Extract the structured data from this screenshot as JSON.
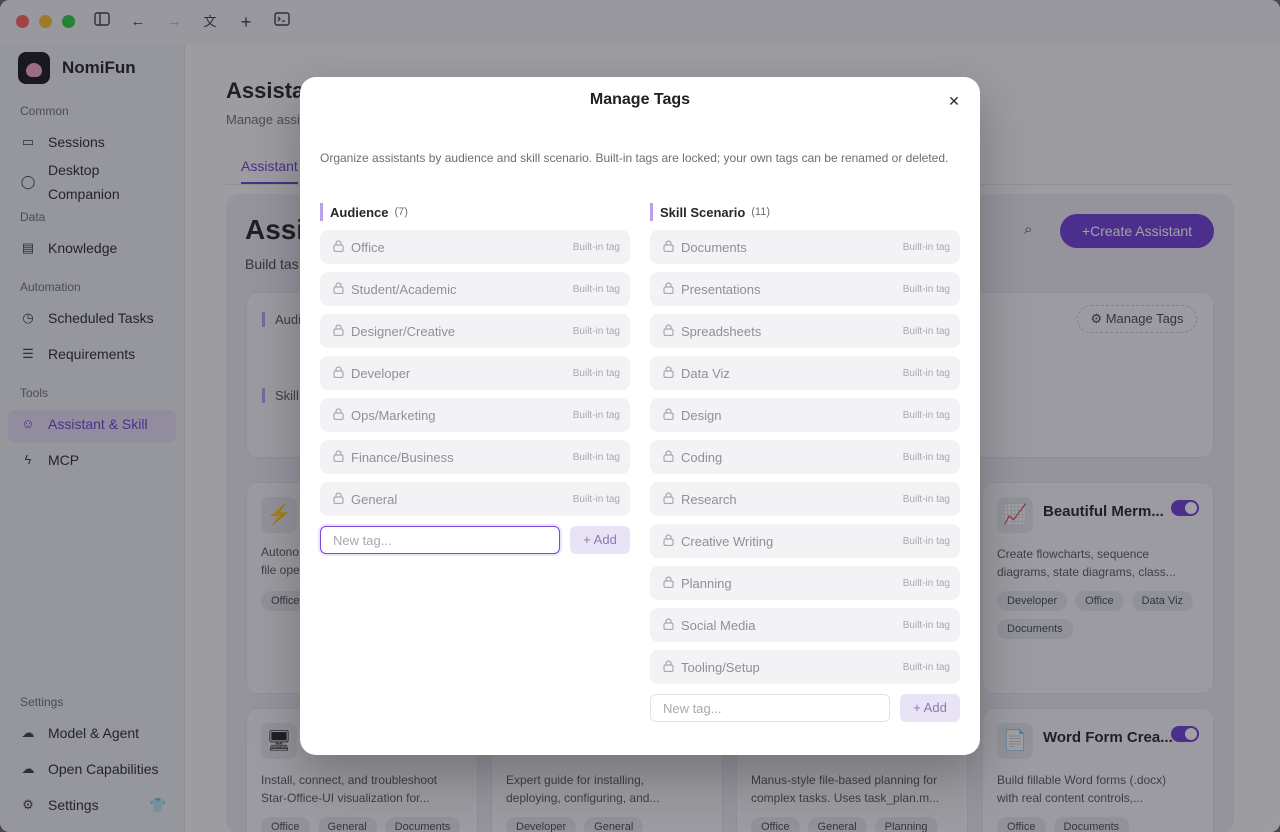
{
  "app": {
    "name": "NomiFun"
  },
  "titlebar": {
    "icons": [
      "sidebar-toggle-icon",
      "back-arrow-icon",
      "forward-arrow-icon",
      "translate-icon",
      "plus-icon",
      "terminal-icon"
    ]
  },
  "sidebar": {
    "sections": {
      "common": "Common",
      "data": "Data",
      "automation": "Automation",
      "tools": "Tools",
      "settings": "Settings"
    },
    "items": {
      "sessions": "Sessions",
      "desktop_companion_1": "Desktop",
      "desktop_companion_2": "Companion",
      "knowledge": "Knowledge",
      "scheduled_tasks": "Scheduled Tasks",
      "requirements": "Requirements",
      "assistant_skill": "Assistant & Skill",
      "mcp": "MCP",
      "model_agent": "Model & Agent",
      "open_capabilities": "Open Capabilities",
      "settings": "Settings"
    }
  },
  "background": {
    "title": "Assista",
    "subtitle": "Manage assi",
    "tab": "Assistant",
    "heading": "Assi",
    "heading_sub": "Build tas",
    "create_button": "+Create Assistant",
    "manage_tags_button": "Manage Tags",
    "filter_audience": "Audie",
    "filter_skill": "Skill",
    "cards": [
      {
        "icon": "⚡",
        "title": "",
        "desc": "Autono\nfile ope",
        "tags": [
          "Office"
        ]
      },
      {
        "icon": "📈",
        "title": "Beautiful Merm...",
        "desc": "Create flowcharts, sequence diagrams, state diagrams, class...",
        "tags": [
          "Developer",
          "Office",
          "Data Viz",
          "Documents"
        ]
      },
      {
        "icon": "🖥",
        "title": "",
        "desc": "Install, connect, and troubleshoot Star-Office-UI visualization for...",
        "tags": [
          "Office",
          "General",
          "Documents"
        ]
      },
      {
        "icon": "",
        "title": "",
        "desc": "Expert guide for installing, deploying, configuring, and...",
        "tags": [
          "Developer",
          "General"
        ]
      },
      {
        "icon": "",
        "title": "",
        "desc": "Manus-style file-based planning for complex tasks. Uses task_plan.m...",
        "tags": [
          "Office",
          "General",
          "Planning"
        ]
      },
      {
        "icon": "📄",
        "title": "Word Form Crea...",
        "desc": "Build fillable Word forms (.docx) with real content controls,...",
        "tags": [
          "Office",
          "Documents"
        ]
      }
    ]
  },
  "modal": {
    "title": "Manage Tags",
    "description": "Organize assistants by audience and skill scenario. Built-in tags are locked; your own tags can be renamed or deleted.",
    "builtin_label": "Built-in tag",
    "audience": {
      "title": "Audience",
      "count": "(7)",
      "tags": [
        "Office",
        "Student/Academic",
        "Designer/Creative",
        "Developer",
        "Ops/Marketing",
        "Finance/Business",
        "General"
      ],
      "input_placeholder": "New tag...",
      "add_label": "Add"
    },
    "skill": {
      "title": "Skill Scenario",
      "count": "(11)",
      "tags": [
        "Documents",
        "Presentations",
        "Spreadsheets",
        "Data Viz",
        "Design",
        "Coding",
        "Research",
        "Creative Writing",
        "Planning",
        "Social Media",
        "Tooling/Setup"
      ],
      "input_placeholder": "New tag...",
      "add_label": "Add"
    }
  }
}
